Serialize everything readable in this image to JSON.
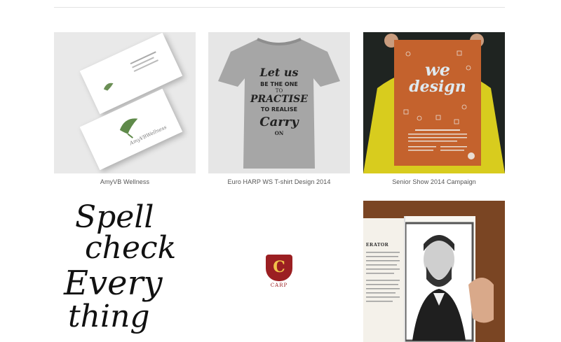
{
  "gallery": {
    "items": [
      {
        "caption": "AmyVB Wellness"
      },
      {
        "caption": "Euro HARP WS T-shirt Design 2014"
      },
      {
        "caption": "Senior Show 2014 Campaign"
      },
      {
        "caption": ""
      },
      {
        "caption": ""
      },
      {
        "caption": ""
      }
    ]
  },
  "artwork": {
    "card_brand": "AmyVBWellness",
    "tee_lines": [
      "Let us",
      "BE THE ONE",
      "TO",
      "PRACTISE",
      "TO REALISE",
      "Carry",
      "ON"
    ],
    "poster_title": [
      "we",
      "design"
    ],
    "lettering": [
      "Spell",
      "check",
      "Every",
      "thing"
    ],
    "logo_letter": "C",
    "logo_text": "CARP",
    "book_heading": "ERATOR"
  },
  "colors": {
    "accent_red": "#9b1f22",
    "poster_orange": "#c4622d",
    "logo_gold": "#f1c24a"
  }
}
